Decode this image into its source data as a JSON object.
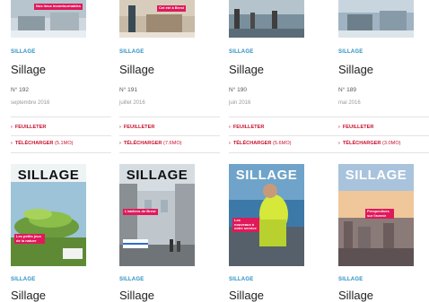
{
  "category": "SILLAGE",
  "items": [
    {
      "title": "Sillage",
      "number": "N° 192",
      "date": "septembre 2016",
      "read": "FEUILLETER",
      "download": "TÉLÉCHARGER",
      "size": "(5.1MO)",
      "cover_tag": "Nos lieux incontournables"
    },
    {
      "title": "Sillage",
      "number": "N° 191",
      "date": "juillet 2016",
      "read": "FEUILLETER",
      "download": "TÉLÉCHARGER",
      "size": "(7.6MO)",
      "cover_tag": "Cet été à Brest"
    },
    {
      "title": "Sillage",
      "number": "N° 190",
      "date": "juin 2016",
      "read": "FEUILLETER",
      "download": "TÉLÉCHARGER",
      "size": "(5.6MO)",
      "cover_tag": ""
    },
    {
      "title": "Sillage",
      "number": "N° 189",
      "date": "mai 2016",
      "read": "FEUILLETER",
      "download": "TÉLÉCHARGER",
      "size": "(3.0MO)",
      "cover_tag": ""
    }
  ],
  "items_row2": [
    {
      "cover_title": "SILLAGE",
      "cover_tag": "Les petits jeux de la nature",
      "title": "Sillage"
    },
    {
      "cover_title": "SILLAGE",
      "cover_tag": "L'ateliers de Brest",
      "title": "Sillage"
    },
    {
      "cover_title": "SILLAGE",
      "cover_tag": "Les nouveaux à votre service",
      "title": "Sillage"
    },
    {
      "cover_title": "SILLAGE",
      "cover_tag": "Perspectives sur l'avenir",
      "title": "Sillage"
    }
  ],
  "colors": {
    "accent": "#c8102e",
    "category": "#2a8fc4"
  }
}
